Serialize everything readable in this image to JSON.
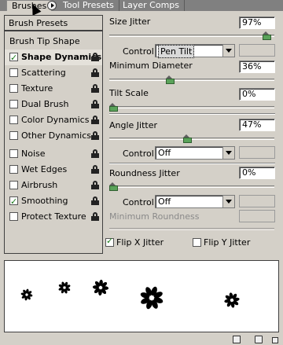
{
  "tabs": [
    {
      "label": "Brushes",
      "active": true
    },
    {
      "label": "Tool Presets",
      "active": false
    },
    {
      "label": "Layer Comps",
      "active": false
    }
  ],
  "left": {
    "presets_label": "Brush Presets",
    "tip_shape_label": "Brush Tip Shape",
    "items": [
      {
        "label": "Shape Dynamics",
        "checked": true,
        "selected": true
      },
      {
        "label": "Scattering",
        "checked": false
      },
      {
        "label": "Texture",
        "checked": false
      },
      {
        "label": "Dual Brush",
        "checked": false
      },
      {
        "label": "Color Dynamics",
        "checked": false
      },
      {
        "label": "Other Dynamics",
        "checked": false
      },
      {
        "label": "Noise",
        "checked": false
      },
      {
        "label": "Wet Edges",
        "checked": false
      },
      {
        "label": "Airbrush",
        "checked": false
      },
      {
        "label": "Smoothing",
        "checked": true
      },
      {
        "label": "Protect Texture",
        "checked": false
      }
    ]
  },
  "right": {
    "size_jitter": {
      "label": "Size Jitter",
      "value": "97%",
      "level": 0.97
    },
    "control1": {
      "label": "Control:",
      "value": "Pen Tilt"
    },
    "min_diameter": {
      "label": "Minimum Diameter",
      "value": "36%",
      "level": 0.36
    },
    "tilt_scale": {
      "label": "Tilt Scale",
      "value": "0%",
      "level": 0
    },
    "angle_jitter": {
      "label": "Angle Jitter",
      "value": "47%",
      "level": 0.47
    },
    "control2": {
      "label": "Control:",
      "value": "Off"
    },
    "roundness_jitter": {
      "label": "Roundness Jitter",
      "value": "0%",
      "level": 0
    },
    "control3": {
      "label": "Control:",
      "value": "Off"
    },
    "min_roundness": {
      "label": "Minimum Roundness",
      "value": ""
    },
    "flip_x": {
      "label": "Flip X Jitter",
      "checked": true
    },
    "flip_y": {
      "label": "Flip Y Jitter",
      "checked": false
    }
  },
  "colors": {
    "panel": "#d4d0c8",
    "slider_thumb": "#5aa35a",
    "check": "#1a7a1a"
  }
}
